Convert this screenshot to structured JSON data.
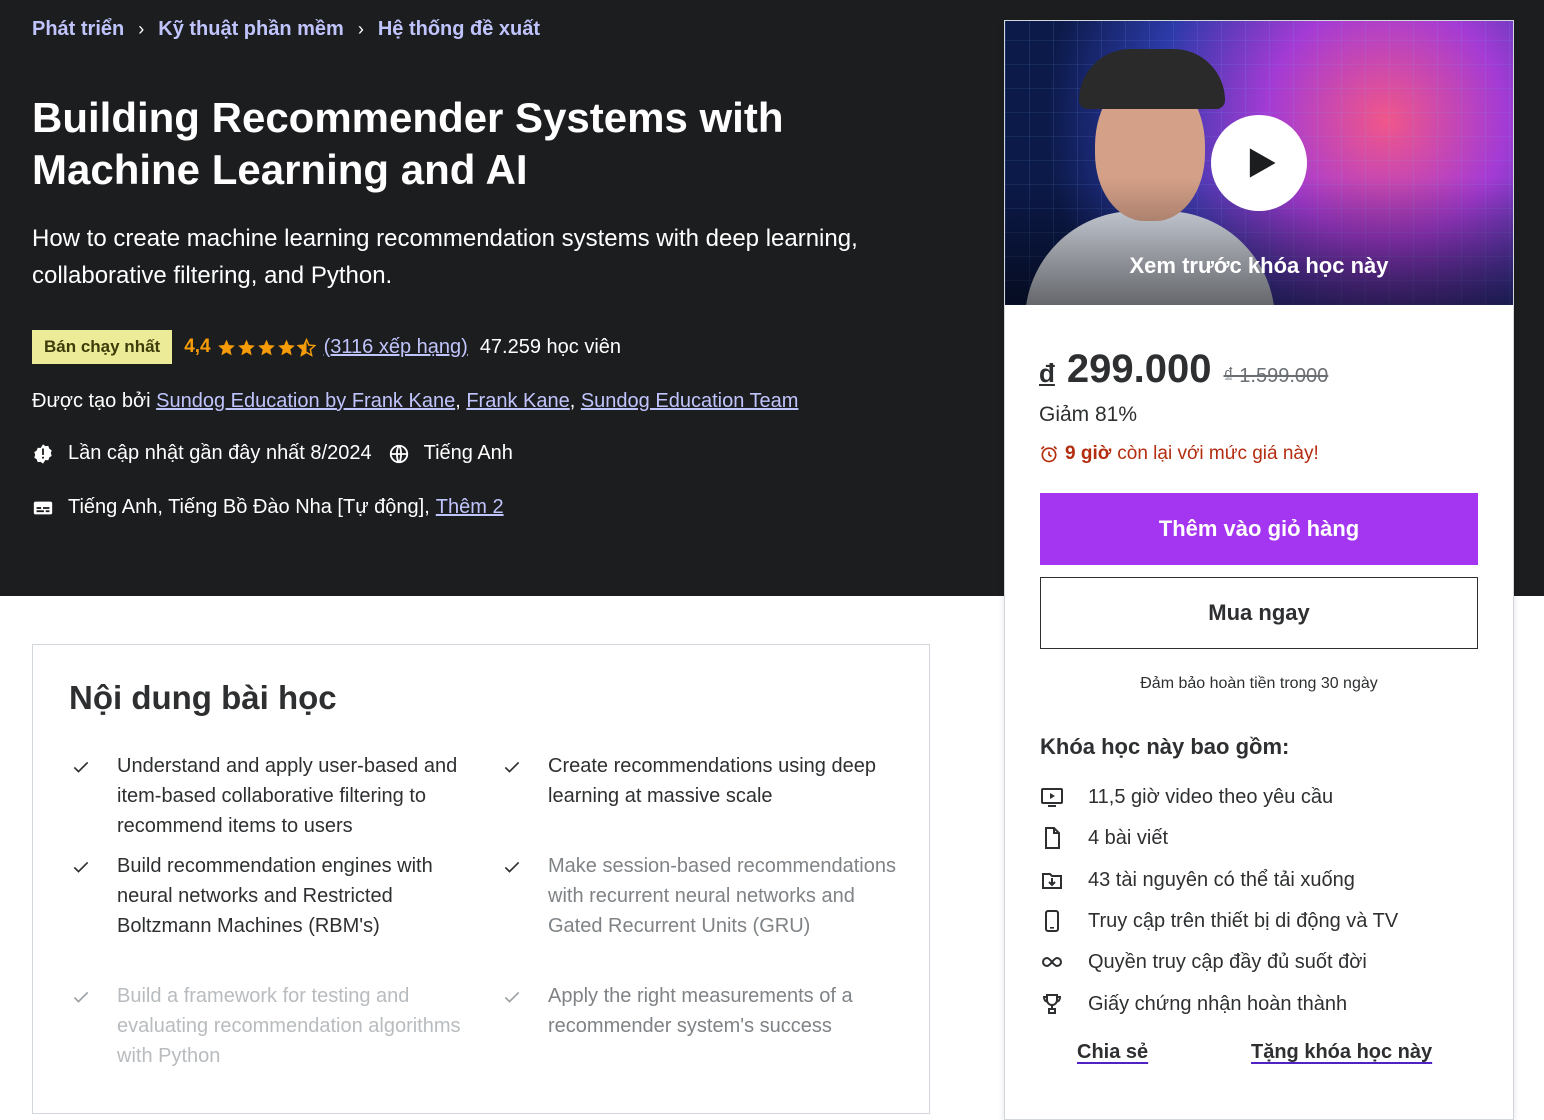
{
  "breadcrumb": [
    "Phát triển",
    "Kỹ thuật phần mềm",
    "Hệ thống đề xuất"
  ],
  "course": {
    "title": "Building Recommender Systems with Machine Learning and AI",
    "subtitle": "How to create machine learning recommendation systems with deep learning, collaborative filtering, and Python.",
    "badge": "Bán chạy nhất",
    "rating": "4,4",
    "rating_value": 4.4,
    "rating_count": "(3116 xếp hạng)",
    "students": "47.259 học viên",
    "created_by_label": "Được tạo bởi",
    "instructors": [
      "Sundog Education by Frank Kane",
      "Frank Kane",
      "Sundog Education Team"
    ],
    "last_updated": "Lần cập nhật gần đây nhất 8/2024",
    "language": "Tiếng Anh",
    "captions": "Tiếng Anh, Tiếng Bồ Đào Nha [Tự động],",
    "captions_more": "Thêm 2"
  },
  "learn": {
    "title": "Nội dung bài học",
    "items": [
      "Understand and apply user-based and item-based collaborative filtering to recommend items to users",
      "Create recommendations using deep learning at massive scale",
      "Build recommendation engines with neural networks and Restricted Boltzmann Machines (RBM's)",
      "Make session-based recommendations with recurrent neural networks and Gated Recurrent Units (GRU)",
      "Build a framework for testing and evaluating recommendation algorithms with Python",
      "Apply the right measurements of a recommender system's success"
    ]
  },
  "sidebar": {
    "preview_label": "Xem trước khóa học này",
    "currency": "đ",
    "price": "299.000",
    "original_price": "₫ 1.599.000",
    "discount": "Giảm 81%",
    "timer_bold": "9 giờ",
    "timer_rest": "còn lại với mức giá này!",
    "add_to_cart": "Thêm vào giỏ hàng",
    "buy_now": "Mua ngay",
    "guarantee": "Đảm bảo hoàn tiền trong 30 ngày",
    "includes_title": "Khóa học này bao gồm:",
    "includes": [
      {
        "icon": "video-icon",
        "text": "11,5 giờ video theo yêu cầu"
      },
      {
        "icon": "file-icon",
        "text": "4 bài viết"
      },
      {
        "icon": "download-icon",
        "text": "43 tài nguyên có thể tải xuống"
      },
      {
        "icon": "mobile-icon",
        "text": "Truy cập trên thiết bị di động và TV"
      },
      {
        "icon": "infinity-icon",
        "text": "Quyền truy cập đầy đủ suốt đời"
      },
      {
        "icon": "trophy-icon",
        "text": "Giấy chứng nhận hoàn thành"
      }
    ],
    "share": "Chia sẻ",
    "gift": "Tặng khóa học này"
  },
  "colors": {
    "hero_bg": "#1c1d1f",
    "link_purple": "#c0c4fc",
    "star": "#f69c08",
    "cta": "#a435f0",
    "badge": "#eceb98",
    "timer": "#b32d0f"
  }
}
